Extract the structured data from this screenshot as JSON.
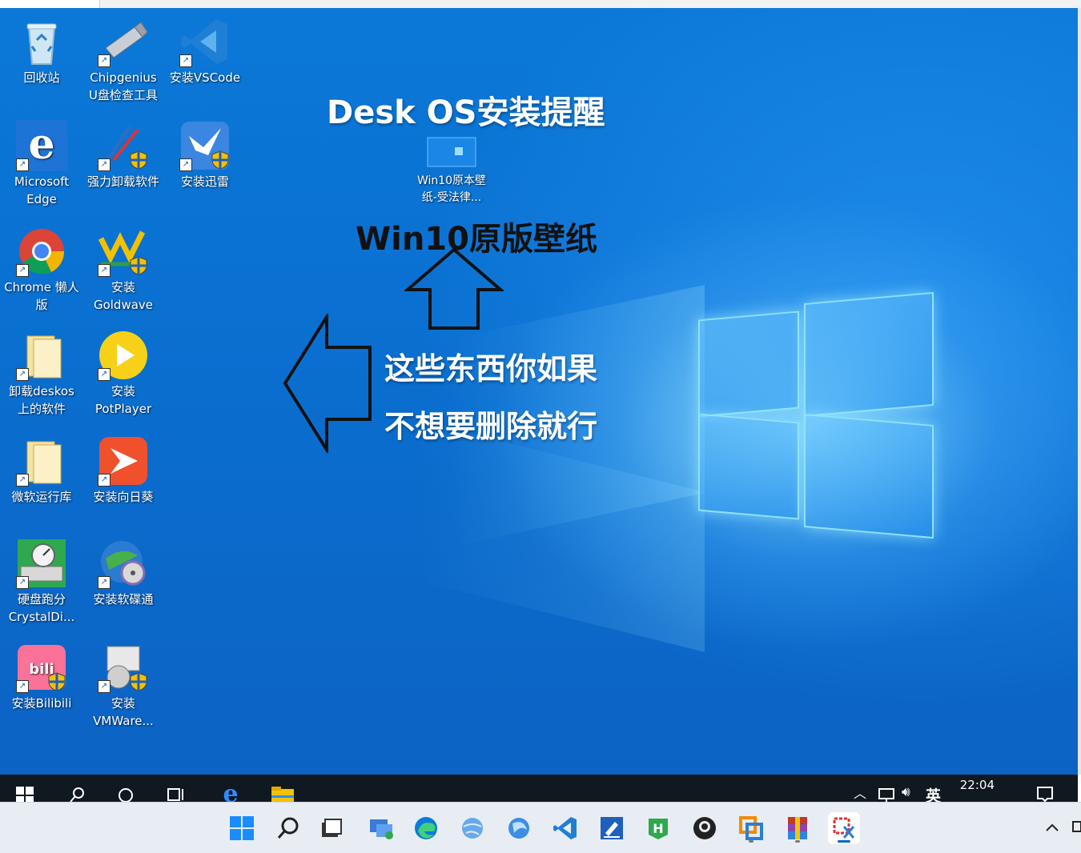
{
  "desktop_icons": [
    {
      "name": "recycle-bin",
      "label": "回收站"
    },
    {
      "name": "chipgenius",
      "label": "Chipgenius\nU盘检查工具"
    },
    {
      "name": "install-vscode",
      "label": "安装VSCode"
    },
    {
      "name": "microsoft-edge",
      "label": "Microsoft\nEdge"
    },
    {
      "name": "uninstaller",
      "label": "强力卸载软件"
    },
    {
      "name": "install-xunlei",
      "label": "安装迅雷"
    },
    {
      "name": "chrome-lazy",
      "label": "Chrome 懒人\n版"
    },
    {
      "name": "install-goldwave",
      "label": "安装\nGoldwave"
    },
    {
      "name": "uninstall-deskos",
      "label": "卸载deskos\n上的软件"
    },
    {
      "name": "install-potplayer",
      "label": "安装\nPotPlayer"
    },
    {
      "name": "ms-runtime",
      "label": "微软运行库"
    },
    {
      "name": "install-sunlogin",
      "label": "安装向日葵"
    },
    {
      "name": "crystaldisk",
      "label": "硬盘跑分\nCrystalDi..."
    },
    {
      "name": "install-ultraiso",
      "label": "安装软碟通"
    },
    {
      "name": "install-bilibili",
      "label": "安装Bilibili"
    },
    {
      "name": "install-vmware",
      "label": "安装\nVMWare..."
    },
    {
      "name": "win10-wallpaper",
      "label": "Win10原本壁\n纸-受法律..."
    }
  ],
  "overlay": {
    "title": "Desk OS安装提醒",
    "wallpaper_caption": "Win10原版壁纸",
    "note_line1": "这些东西你如果",
    "note_line2": "不想要删除就行"
  },
  "taskbar_win10": {
    "tray_text": "英",
    "clock": "22:04"
  },
  "colors": {
    "desktop_blue": "#0a6fd0",
    "taskbar_dark": "#101820",
    "taskbar11_bg": "#e8edf3",
    "accent": "#0067c0"
  }
}
